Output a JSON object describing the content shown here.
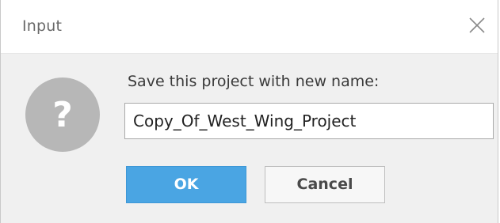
{
  "window": {
    "title": "Input"
  },
  "dialog": {
    "prompt": "Save this project with new name:",
    "input_value": "Copy_Of_West_Wing_Project",
    "icon": "question-icon"
  },
  "buttons": {
    "ok_label": "OK",
    "cancel_label": "Cancel"
  },
  "colors": {
    "ok_button": "#4aa5e3",
    "icon_circle": "#b7b7b7",
    "body_background": "#f0f0f0"
  }
}
